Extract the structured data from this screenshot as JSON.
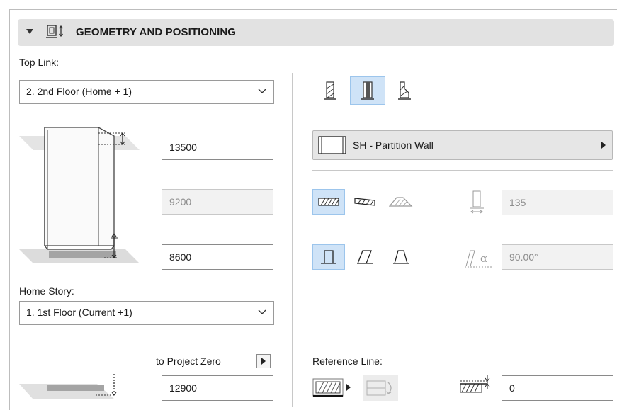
{
  "panel": {
    "title": "GEOMETRY AND POSITIONING"
  },
  "top_link": {
    "label": "Top Link:",
    "selected": "2. 2nd Floor (Home + 1)"
  },
  "height": {
    "top_offset": "13500",
    "wall_height": "9200",
    "bottom_offset": "8600"
  },
  "home_story": {
    "label": "Home Story:",
    "selected": "1. 1st Floor (Current +1)"
  },
  "project_zero": {
    "label": "to Project Zero",
    "value": "12900"
  },
  "profile": {
    "label": "SH - Partition Wall"
  },
  "thickness": {
    "value": "135"
  },
  "angle": {
    "value": "90.00°",
    "symbol": "α"
  },
  "reference_line": {
    "label": "Reference Line:",
    "offset_value": "0"
  },
  "colors": {
    "active_button": "#cfe3f7",
    "header_bg": "#e2e2e2"
  }
}
